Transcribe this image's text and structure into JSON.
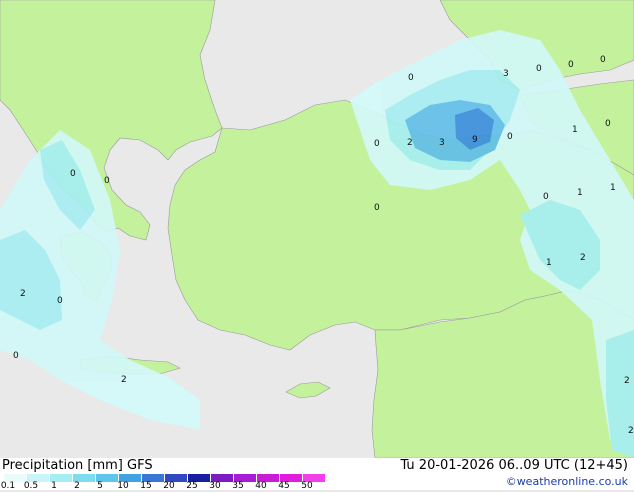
{
  "map": {
    "value_labels": [
      "0",
      "0",
      "0",
      "0",
      "0",
      "0",
      "0",
      "0",
      "0",
      "0",
      "0",
      "0",
      "0",
      "2",
      "2",
      "3",
      "9",
      "3",
      "1",
      "1",
      "1",
      "1",
      "2",
      "2",
      "2",
      "2"
    ]
  },
  "footer": {
    "title": "Precipitation [mm]  GFS",
    "valid": "Tu 20-01-2026 06..09 UTC (12+45)",
    "credit": "©weatheronline.co.uk"
  },
  "legend": {
    "ticks": [
      "0.1",
      "0.5",
      "1",
      "2",
      "5",
      "10",
      "15",
      "20",
      "25",
      "30",
      "35",
      "40",
      "45",
      "50"
    ],
    "colors": [
      "#e8fcfc",
      "#c8f6f8",
      "#a2eef4",
      "#7ddcef",
      "#5ec6ec",
      "#3fa3e3",
      "#3a76d6",
      "#3049c2",
      "#1a1fa0",
      "#7e1cc4",
      "#a81cd2",
      "#c81cd6",
      "#e01ce0",
      "#f040ec"
    ]
  },
  "colors": {
    "sea": "#e9e9e9",
    "land": "#c4f29c",
    "precip_light": "#d2f8f8",
    "precip_mid": "#a6eef2",
    "precip_heavy": "#62bfe8",
    "precip_max": "#3c8fdc"
  }
}
